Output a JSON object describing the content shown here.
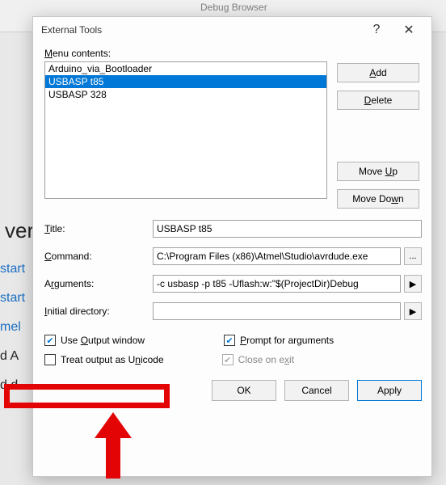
{
  "background": {
    "ribbonTab": "Debug Browser",
    "verText": "ver",
    "sideLinks": [
      "start",
      "start",
      "mel",
      "d A",
      "d d"
    ]
  },
  "dialog": {
    "title": "External Tools",
    "help": "?",
    "close": "✕",
    "menuContentsLabel_pre": "",
    "menuContentsLabel_u": "M",
    "menuContentsLabel_post": "enu contents:",
    "items": [
      {
        "label": "Arduino_via_Bootloader",
        "selected": false
      },
      {
        "label": "USBASP t85",
        "selected": true
      },
      {
        "label": "USBASP 328",
        "selected": false
      }
    ],
    "buttons": {
      "add_u": "A",
      "add_post": "dd",
      "delete_u": "D",
      "delete_post": "elete",
      "moveUp_pre": "Move ",
      "moveUp_u": "U",
      "moveUp_post": "p",
      "moveDown_pre": "Move Do",
      "moveDown_u": "w",
      "moveDown_post": "n"
    },
    "fields": {
      "title_u": "T",
      "title_post": "itle:",
      "title_val": "USBASP t85",
      "command_u": "C",
      "command_post": "ommand:",
      "command_val": "C:\\Program Files (x86)\\Atmel\\Studio\\avrdude.exe",
      "arguments_pre": "A",
      "arguments_u": "r",
      "arguments_post": "guments:",
      "arguments_val": "-c usbasp -p t85 -Uflash:w:\"$(ProjectDir)Debug",
      "initdir_u": "I",
      "initdir_post": "nitial directory:",
      "initdir_val": "",
      "browse": "...",
      "arrow": "▶"
    },
    "checks": {
      "useOutput_pre": "Use ",
      "useOutput_u": "O",
      "useOutput_post": "utput window",
      "useOutput_checked": true,
      "prompt_u": "P",
      "prompt_post": "rompt for arguments",
      "prompt_checked": true,
      "unicode_pre": "Treat output as U",
      "unicode_u": "n",
      "unicode_post": "icode",
      "unicode_checked": false,
      "closeOnExit_pre": "Close on e",
      "closeOnExit_u": "x",
      "closeOnExit_post": "it",
      "closeOnExit_checked": true
    },
    "bottom": {
      "ok": "OK",
      "cancel": "Cancel",
      "apply": "Apply"
    }
  }
}
